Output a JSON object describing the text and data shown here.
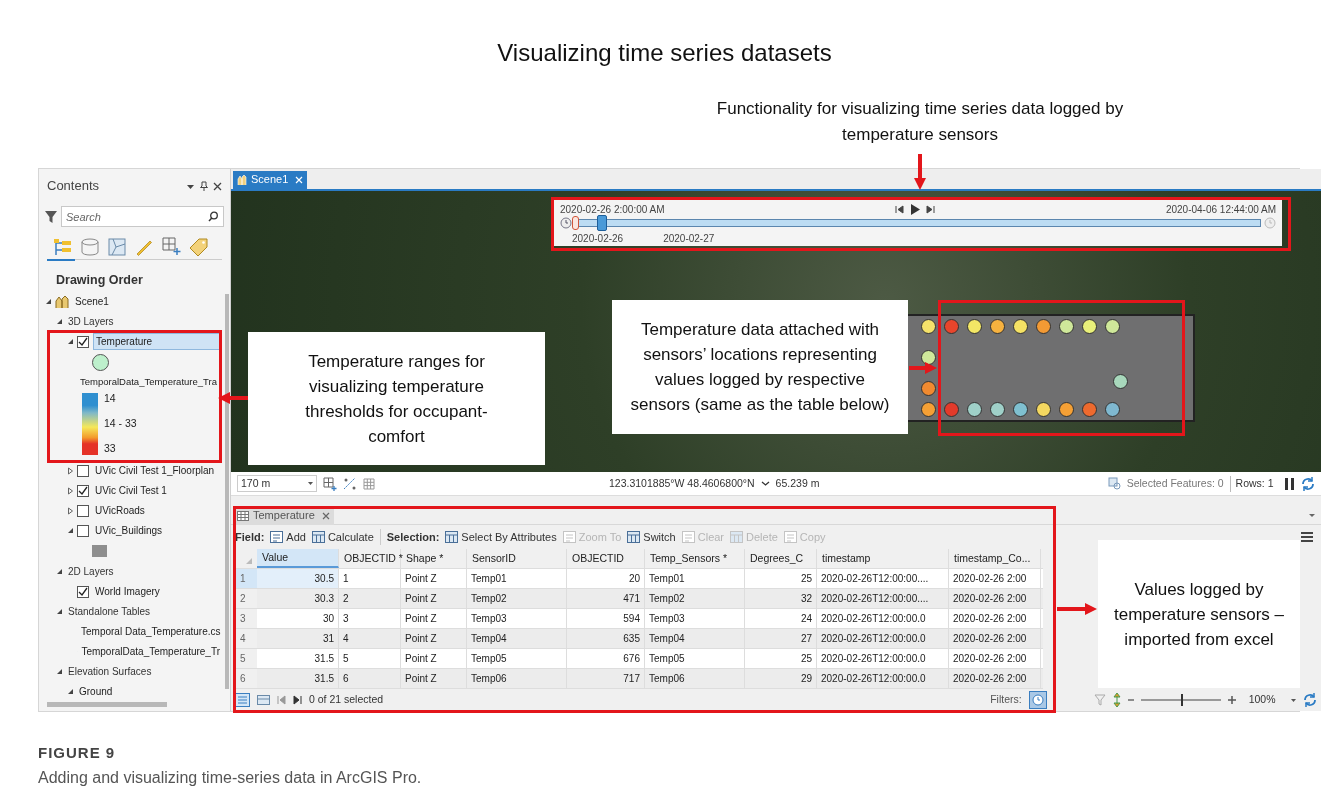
{
  "title": "Visualizing time series datasets",
  "annotations": [
    {
      "kind": "top",
      "text": "Functionality for visualizing time series data logged by temperature sensors"
    },
    {
      "kind": "left",
      "text": "Temperature ranges for visualizing temperature thresholds for occupant-comfort"
    },
    {
      "kind": "middle",
      "text": "Temperature data attached with sensors’ locations representing values logged by respective sensors (same as the table below)"
    },
    {
      "kind": "right",
      "text": "Values logged by temperature sensors – imported from excel"
    }
  ],
  "contents": {
    "title": "Contents",
    "search": {
      "placeholder": "Search"
    },
    "heading": "Drawing Order",
    "tree": [
      {
        "label": "Scene1",
        "kind": "scene",
        "expanded": true,
        "children": [
          {
            "label": "3D Layers",
            "kind": "group",
            "expanded": true,
            "children": [
              {
                "label": "Temperature",
                "kind": "layer",
                "expanded": true,
                "checked": true,
                "selected": true,
                "symbol": {
                  "kind": "circle",
                  "color": "#bdf0cc"
                },
                "legend": {
                  "field": "TemporalData_Temperature_Tra",
                  "high": "14",
                  "mid": "14 - 33",
                  "low": "33"
                }
              },
              {
                "label": "UVic Civil Test 1_Floorplan",
                "kind": "layer",
                "expanded": false,
                "checked": false,
                "selected": false
              },
              {
                "label": "UVic Civil Test 1",
                "kind": "layer",
                "expanded": false,
                "checked": true,
                "selected": false
              },
              {
                "label": "UVicRoads",
                "kind": "layer",
                "expanded": false,
                "checked": false,
                "selected": false
              },
              {
                "label": "UVic_Buildings",
                "kind": "layer",
                "expanded": true,
                "checked": false,
                "selected": false,
                "symbol": {
                  "kind": "square",
                  "color": "#8e8e8e"
                }
              }
            ]
          },
          {
            "label": "2D Layers",
            "kind": "group",
            "expanded": true,
            "children": [
              {
                "label": "World Imagery",
                "kind": "layer",
                "checked": true,
                "selected": false
              }
            ]
          },
          {
            "label": "Standalone Tables",
            "kind": "group",
            "expanded": true,
            "children": [
              {
                "label": "Temporal Data_Temperature.cs",
                "kind": "table"
              },
              {
                "label": "TemporalData_Temperature_Tr",
                "kind": "table"
              }
            ]
          },
          {
            "label": "Elevation Surfaces",
            "kind": "group",
            "expanded": true,
            "children": [
              {
                "label": "Ground",
                "kind": "surface",
                "expanded": true
              }
            ]
          }
        ]
      }
    ]
  },
  "scene_tab": {
    "label": "Scene1"
  },
  "timeline": {
    "start": "2020-02-26 2:00:00 AM",
    "end": "2020-04-06 12:44:00 AM",
    "level": 0.03,
    "ticks": [
      "2020-02-26",
      "2020-02-27"
    ]
  },
  "map": {
    "sensors": {
      "top": [
        {
          "color": "#f5e26a"
        },
        {
          "color": "#e8452c"
        },
        {
          "color": "#f3e765"
        },
        {
          "color": "#f7b23f"
        },
        {
          "color": "#f5e264"
        },
        {
          "color": "#f39a34"
        },
        {
          "color": "#cfe89a"
        },
        {
          "color": "#e9f07a"
        },
        {
          "color": "#cfe89a"
        }
      ],
      "left": [
        {
          "color": "#cfe89a"
        },
        {
          "color": "#f08a30"
        }
      ],
      "bottom": [
        {
          "color": "#f5a035"
        },
        {
          "color": "#e33a2a"
        },
        {
          "color": "#9fd0c8"
        },
        {
          "color": "#9fd0c8"
        },
        {
          "color": "#7fc0d0"
        },
        {
          "color": "#f4d860"
        },
        {
          "color": "#f5a035"
        },
        {
          "color": "#ee6a2e"
        },
        {
          "color": "#7fb8d0"
        }
      ],
      "right": [
        {
          "color": "#a8d8bc"
        }
      ]
    }
  },
  "map_status": {
    "scale": "170 m",
    "coordinates": "123.3101885°W 48.4606800°N",
    "elevation": "65.239 m",
    "selected_features": "Selected Features: 0",
    "rows": "Rows: 1"
  },
  "table_view": {
    "tab": "Temperature",
    "toolbar": [
      {
        "kind": "label",
        "label": "Field:"
      },
      {
        "kind": "button",
        "label": "Add",
        "disabled": false
      },
      {
        "kind": "button",
        "label": "Calculate",
        "disabled": false
      },
      {
        "kind": "label",
        "label": "Selection:"
      },
      {
        "kind": "button",
        "label": "Select By Attributes",
        "disabled": false
      },
      {
        "kind": "button",
        "label": "Zoom To",
        "disabled": true
      },
      {
        "kind": "button",
        "label": "Switch",
        "disabled": false
      },
      {
        "kind": "button",
        "label": "Clear",
        "disabled": true
      },
      {
        "kind": "button",
        "label": "Delete",
        "disabled": true
      },
      {
        "kind": "button",
        "label": "Copy",
        "disabled": true
      }
    ],
    "columns": [
      {
        "label": "Value",
        "kind": "number",
        "selected": true
      },
      {
        "label": "OBJECTID *",
        "kind": "text",
        "selected": false
      },
      {
        "label": "Shape *",
        "kind": "text",
        "selected": false
      },
      {
        "label": "SensorID",
        "kind": "text",
        "selected": false
      },
      {
        "label": "OBJECTID",
        "kind": "number",
        "selected": false
      },
      {
        "label": "Temp_Sensors *",
        "kind": "text",
        "selected": false
      },
      {
        "label": "Degrees_C",
        "kind": "number",
        "selected": false
      },
      {
        "label": "timestamp",
        "kind": "text",
        "selected": false
      },
      {
        "label": "timestamp_Co...",
        "kind": "text",
        "selected": false
      }
    ],
    "rows": [
      {
        "number": "1",
        "current": true,
        "cells": [
          "30.5",
          "1",
          "Point Z",
          "Temp01",
          "20",
          "Temp01",
          "25",
          "2020-02-26T12:00:00....",
          "2020-02-26 2:00"
        ]
      },
      {
        "number": "2",
        "current": false,
        "cells": [
          "30.3",
          "2",
          "Point Z",
          "Temp02",
          "471",
          "Temp02",
          "32",
          "2020-02-26T12:00:00....",
          "2020-02-26 2:00"
        ]
      },
      {
        "number": "3",
        "current": false,
        "cells": [
          "30",
          "3",
          "Point Z",
          "Temp03",
          "594",
          "Temp03",
          "24",
          "2020-02-26T12:00:00.0",
          "2020-02-26 2:00"
        ]
      },
      {
        "number": "4",
        "current": false,
        "cells": [
          "31",
          "4",
          "Point Z",
          "Temp04",
          "635",
          "Temp04",
          "27",
          "2020-02-26T12:00:00.0",
          "2020-02-26 2:00"
        ]
      },
      {
        "number": "5",
        "current": false,
        "cells": [
          "31.5",
          "5",
          "Point Z",
          "Temp05",
          "676",
          "Temp05",
          "25",
          "2020-02-26T12:00:00.0",
          "2020-02-26 2:00"
        ]
      },
      {
        "number": "6",
        "current": false,
        "cells": [
          "31.5",
          "6",
          "Point Z",
          "Temp06",
          "717",
          "Temp06",
          "29",
          "2020-02-26T12:00:00.0",
          "2020-02-26 2:00"
        ]
      }
    ],
    "selection_count": "0 of 21 selected",
    "filters": "Filters:",
    "zoom": {
      "level": 0.5,
      "label": "100%"
    }
  },
  "caption": {
    "label": "FIGURE 9",
    "text": "Adding and visualizing time-series data in ArcGIS Pro."
  }
}
